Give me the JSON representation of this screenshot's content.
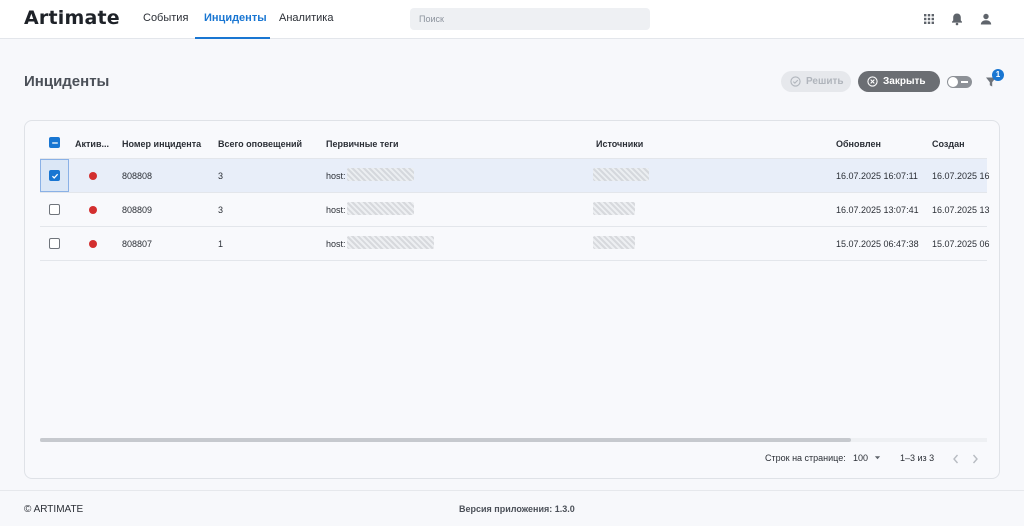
{
  "app": {
    "logo": "Artimate"
  },
  "nav": {
    "tabs": [
      {
        "label": "События"
      },
      {
        "label": "Инциденты"
      },
      {
        "label": "Аналитика"
      }
    ],
    "active_tab": "Инциденты"
  },
  "search": {
    "placeholder": "Поиск"
  },
  "topbar_icons": [
    "apps-grid-icon",
    "bell-icon",
    "user-icon"
  ],
  "page": {
    "title": "Инциденты",
    "resolve_label": "Решить",
    "close_label": "Закрыть",
    "filter_badge": "1"
  },
  "table": {
    "columns": [
      "Актив...",
      "Номер инцидента",
      "Всего оповещений",
      "Первичные теги",
      "Источники",
      "Обновлен",
      "Создан"
    ],
    "rows": [
      {
        "id": "808808",
        "alerts": "3",
        "tag_prefix": "host:",
        "updated": "16.07.2025 16:07:11",
        "created": "16.07.2025 16",
        "selected": true,
        "status_color": "#d32f2f"
      },
      {
        "id": "808809",
        "alerts": "3",
        "tag_prefix": "host:",
        "updated": "16.07.2025 13:07:41",
        "created": "16.07.2025 13",
        "selected": false,
        "status_color": "#d32f2f"
      },
      {
        "id": "808807",
        "alerts": "1",
        "tag_prefix": "host:",
        "updated": "15.07.2025 06:47:38",
        "created": "15.07.2025 06",
        "selected": false,
        "status_color": "#d32f2f"
      }
    ]
  },
  "pagination": {
    "rows_per_page_label": "Строк на странице:",
    "rows_per_page_value": "100",
    "range": "1–3 из 3"
  },
  "footer": {
    "copyright": "© ARTIMATE",
    "version": "Версия приложения: 1.3.0"
  },
  "colors": {
    "accent": "#1976d2",
    "status_active": "#d32f2f",
    "close_button": "#6b6e73"
  }
}
